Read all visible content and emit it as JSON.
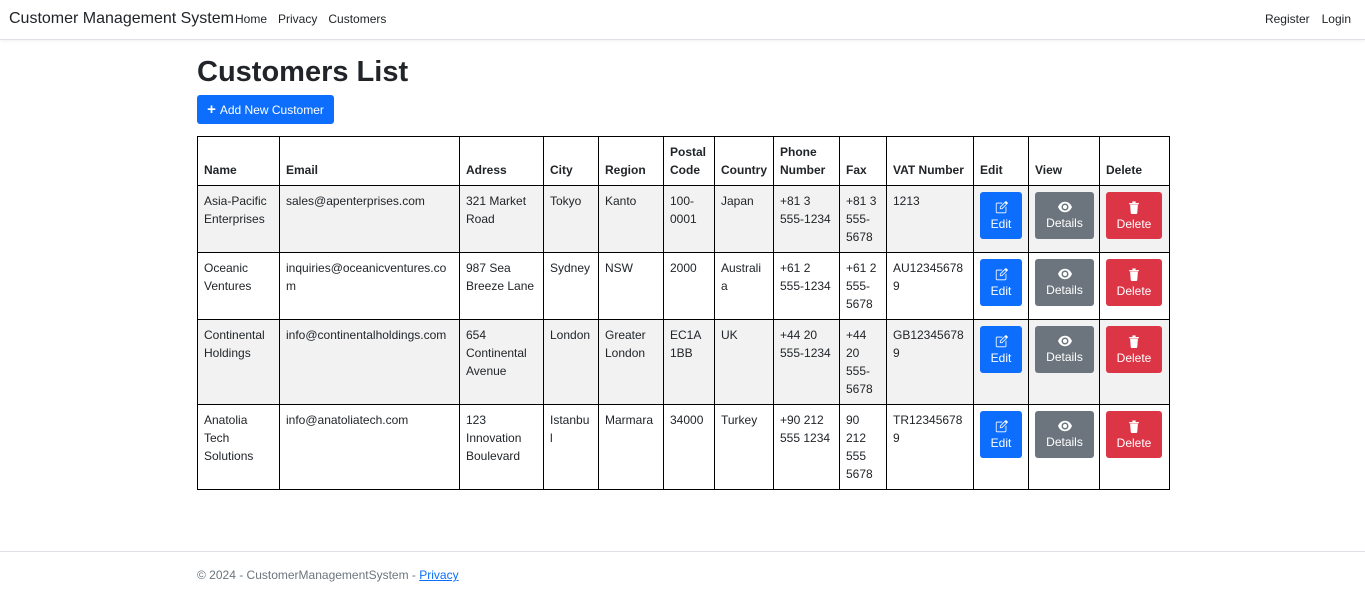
{
  "navbar": {
    "brand": "Customer Management System",
    "left_links": [
      "Home",
      "Privacy",
      "Customers"
    ],
    "right_links": [
      "Register",
      "Login"
    ]
  },
  "main": {
    "title": "Customers List",
    "add_button_label": "Add New Customer",
    "table": {
      "headers": [
        "Name",
        "Email",
        "Adress",
        "City",
        "Region",
        "Postal Code",
        "Country",
        "Phone Number",
        "Fax",
        "VAT Number",
        "Edit",
        "View",
        "Delete"
      ],
      "rows": [
        {
          "name": "Asia-Pacific Enterprises",
          "email": "sales@apenterprises.com",
          "adress": "321 Market Road",
          "city": "Tokyo",
          "region": "Kanto",
          "postal_code": "100-0001",
          "country": "Japan",
          "phone": "+81 3 555-1234",
          "fax": "+81 3 555-5678",
          "vat": "1213"
        },
        {
          "name": "Oceanic Ventures",
          "email": "inquiries@oceanicventures.com",
          "adress": "987 Sea Breeze Lane",
          "city": "Sydney",
          "region": "NSW",
          "postal_code": "2000",
          "country": "Australia",
          "phone": "+61 2 555-1234",
          "fax": "+61 2 555-5678",
          "vat": "AU123456789"
        },
        {
          "name": "Continental Holdings",
          "email": "info@continentalholdings.com",
          "adress": "654 Continental Avenue",
          "city": "London",
          "region": "Greater London",
          "postal_code": "EC1A 1BB",
          "country": "UK",
          "phone": "+44 20 555-1234",
          "fax": "+44 20 555-5678",
          "vat": "GB123456789"
        },
        {
          "name": "Anatolia Tech Solutions",
          "email": "info@anatoliatech.com",
          "adress": "123 Innovation Boulevard",
          "city": "Istanbul",
          "region": "Marmara",
          "postal_code": "34000",
          "country": "Turkey",
          "phone": "+90 212 555 1234",
          "fax": "90 212 555 5678",
          "vat": "TR123456789"
        }
      ],
      "action_labels": {
        "edit": "Edit",
        "details": "Details",
        "delete": "Delete"
      },
      "action_icons": {
        "edit": "pencil-square-icon",
        "details": "eye-icon",
        "delete": "trash-icon"
      }
    }
  },
  "footer": {
    "text": "© 2024 - CustomerManagementSystem - ",
    "link_label": "Privacy"
  },
  "colors": {
    "primary": "#0d6efd",
    "secondary": "#6c757d",
    "danger": "#dc3545",
    "striped_row": "#f2f2f2"
  }
}
